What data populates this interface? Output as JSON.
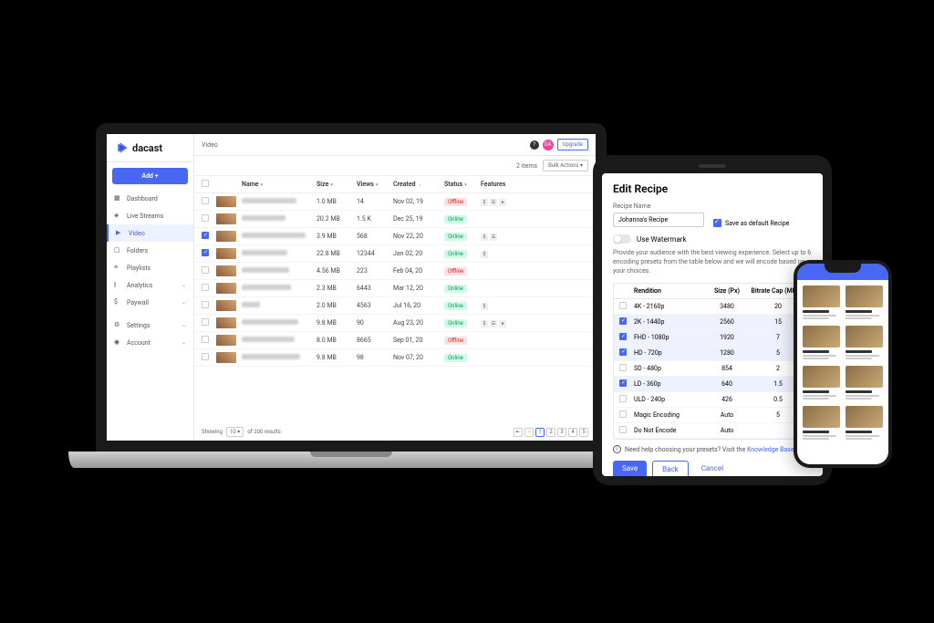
{
  "brand": "dacast",
  "sidebar": {
    "add_button": "Add +",
    "items": [
      {
        "label": "Dashboard",
        "icon": "dashboard"
      },
      {
        "label": "Live Streams",
        "icon": "signal"
      },
      {
        "label": "Video",
        "icon": "play",
        "active": true
      },
      {
        "label": "Folders",
        "icon": "folder"
      },
      {
        "label": "Playlists",
        "icon": "list"
      },
      {
        "label": "Analytics",
        "icon": "bars",
        "expandable": true
      },
      {
        "label": "Paywall",
        "icon": "dollar",
        "expandable": true
      },
      {
        "label": "Settings",
        "icon": "gear",
        "expandable": true
      },
      {
        "label": "Account",
        "icon": "user",
        "expandable": true
      }
    ]
  },
  "header": {
    "breadcrumb": "Video",
    "upgrade": "Upgrade",
    "avatar": "DA"
  },
  "toolbar": {
    "item_count": "2 items",
    "bulk_label": "Bulk Actions"
  },
  "columns": {
    "name": "Name",
    "size": "Size",
    "views": "Views",
    "created": "Created",
    "status": "Status",
    "features": "Features"
  },
  "rows": [
    {
      "checked": false,
      "size": "1.0 MB",
      "views": "14",
      "created": "Nov 02, 19",
      "status": "Offline",
      "features": 3,
      "name_w": 60
    },
    {
      "checked": false,
      "size": "20.2 MB",
      "views": "1.5 K",
      "created": "Dec 25, 19",
      "status": "Online",
      "features": 0,
      "name_w": 48
    },
    {
      "checked": true,
      "size": "3.9 MB",
      "views": "568",
      "created": "Nov 22, 20",
      "status": "Online",
      "features": 2,
      "name_w": 70
    },
    {
      "checked": true,
      "size": "22.8 MB",
      "views": "12344",
      "created": "Jan 02, 20",
      "status": "Online",
      "features": 1,
      "name_w": 50
    },
    {
      "checked": false,
      "size": "4.56 MB",
      "views": "223",
      "created": "Feb 04, 20",
      "status": "Offline",
      "features": 0,
      "name_w": 52
    },
    {
      "checked": false,
      "size": "2.3 MB",
      "views": "6443",
      "created": "Mar 12, 20",
      "status": "Online",
      "features": 0,
      "name_w": 54
    },
    {
      "checked": false,
      "size": "2.0 MB",
      "views": "4563",
      "created": "Jul 16, 20",
      "status": "Online",
      "features": 1,
      "name_w": 20
    },
    {
      "checked": false,
      "size": "9.8 MB",
      "views": "90",
      "created": "Aug 23, 20",
      "status": "Online",
      "features": 3,
      "name_w": 62
    },
    {
      "checked": false,
      "size": "8.0 MB",
      "views": "8665",
      "created": "Sep 01, 20",
      "status": "Offline",
      "features": 0,
      "name_w": 58
    },
    {
      "checked": false,
      "size": "9.8 MB",
      "views": "98",
      "created": "Nov 07, 20",
      "status": "Online",
      "features": 0,
      "name_w": 64
    }
  ],
  "pagination": {
    "showing": "Showing",
    "per_page": "10",
    "total": "of 200 results",
    "pages": [
      "1",
      "2",
      "3",
      "4",
      "5"
    ]
  },
  "tablet": {
    "title": "Edit Recipe",
    "recipe_name_label": "Recipe Name",
    "recipe_name_value": "Johanna's Recipe",
    "save_default": "Save as default Recipe",
    "watermark": "Use Watermark",
    "description": "Provide your audience with the best viewing experience. Select up to 6 encoding presets from the table below and we will encode based on your choices.",
    "th_rendition": "Rendition",
    "th_size": "Size (Px)",
    "th_bitrate": "Bitrate Cap (Mbps)",
    "renditions": [
      {
        "name": "4K - 2160p",
        "size": "3480",
        "bitrate": "20",
        "checked": false
      },
      {
        "name": "2K - 1440p",
        "size": "2560",
        "bitrate": "15",
        "checked": true
      },
      {
        "name": "FHD - 1080p",
        "size": "1920",
        "bitrate": "7",
        "checked": true
      },
      {
        "name": "HD - 720p",
        "size": "1280",
        "bitrate": "5",
        "checked": true
      },
      {
        "name": "SD - 480p",
        "size": "854",
        "bitrate": "2",
        "checked": false
      },
      {
        "name": "LD - 360p",
        "size": "640",
        "bitrate": "1.5",
        "checked": true
      },
      {
        "name": "ULD - 240p",
        "size": "426",
        "bitrate": "0.5",
        "checked": false
      },
      {
        "name": "Magic Encoding",
        "size": "Auto",
        "bitrate": "5",
        "checked": false
      },
      {
        "name": "Do Not Encode",
        "size": "Auto",
        "bitrate": "",
        "checked": false
      }
    ],
    "help_text": "Need help choosing your presets? Visit the ",
    "help_link": "Knowledge Base",
    "save": "Save",
    "back": "Back",
    "cancel": "Cancel"
  }
}
